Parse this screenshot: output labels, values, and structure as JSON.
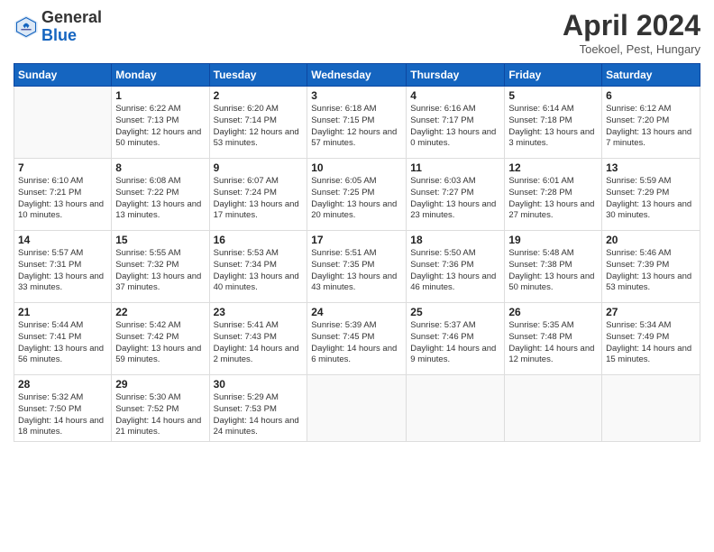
{
  "header": {
    "logo_general": "General",
    "logo_blue": "Blue",
    "month_title": "April 2024",
    "location": "Toekoel, Pest, Hungary"
  },
  "days_of_week": [
    "Sunday",
    "Monday",
    "Tuesday",
    "Wednesday",
    "Thursday",
    "Friday",
    "Saturday"
  ],
  "weeks": [
    [
      {
        "day": "",
        "empty": true
      },
      {
        "day": "1",
        "sunrise": "6:22 AM",
        "sunset": "7:13 PM",
        "daylight": "12 hours and 50 minutes."
      },
      {
        "day": "2",
        "sunrise": "6:20 AM",
        "sunset": "7:14 PM",
        "daylight": "12 hours and 53 minutes."
      },
      {
        "day": "3",
        "sunrise": "6:18 AM",
        "sunset": "7:15 PM",
        "daylight": "12 hours and 57 minutes."
      },
      {
        "day": "4",
        "sunrise": "6:16 AM",
        "sunset": "7:17 PM",
        "daylight": "13 hours and 0 minutes."
      },
      {
        "day": "5",
        "sunrise": "6:14 AM",
        "sunset": "7:18 PM",
        "daylight": "13 hours and 3 minutes."
      },
      {
        "day": "6",
        "sunrise": "6:12 AM",
        "sunset": "7:20 PM",
        "daylight": "13 hours and 7 minutes."
      }
    ],
    [
      {
        "day": "7",
        "sunrise": "6:10 AM",
        "sunset": "7:21 PM",
        "daylight": "13 hours and 10 minutes."
      },
      {
        "day": "8",
        "sunrise": "6:08 AM",
        "sunset": "7:22 PM",
        "daylight": "13 hours and 13 minutes."
      },
      {
        "day": "9",
        "sunrise": "6:07 AM",
        "sunset": "7:24 PM",
        "daylight": "13 hours and 17 minutes."
      },
      {
        "day": "10",
        "sunrise": "6:05 AM",
        "sunset": "7:25 PM",
        "daylight": "13 hours and 20 minutes."
      },
      {
        "day": "11",
        "sunrise": "6:03 AM",
        "sunset": "7:27 PM",
        "daylight": "13 hours and 23 minutes."
      },
      {
        "day": "12",
        "sunrise": "6:01 AM",
        "sunset": "7:28 PM",
        "daylight": "13 hours and 27 minutes."
      },
      {
        "day": "13",
        "sunrise": "5:59 AM",
        "sunset": "7:29 PM",
        "daylight": "13 hours and 30 minutes."
      }
    ],
    [
      {
        "day": "14",
        "sunrise": "5:57 AM",
        "sunset": "7:31 PM",
        "daylight": "13 hours and 33 minutes."
      },
      {
        "day": "15",
        "sunrise": "5:55 AM",
        "sunset": "7:32 PM",
        "daylight": "13 hours and 37 minutes."
      },
      {
        "day": "16",
        "sunrise": "5:53 AM",
        "sunset": "7:34 PM",
        "daylight": "13 hours and 40 minutes."
      },
      {
        "day": "17",
        "sunrise": "5:51 AM",
        "sunset": "7:35 PM",
        "daylight": "13 hours and 43 minutes."
      },
      {
        "day": "18",
        "sunrise": "5:50 AM",
        "sunset": "7:36 PM",
        "daylight": "13 hours and 46 minutes."
      },
      {
        "day": "19",
        "sunrise": "5:48 AM",
        "sunset": "7:38 PM",
        "daylight": "13 hours and 50 minutes."
      },
      {
        "day": "20",
        "sunrise": "5:46 AM",
        "sunset": "7:39 PM",
        "daylight": "13 hours and 53 minutes."
      }
    ],
    [
      {
        "day": "21",
        "sunrise": "5:44 AM",
        "sunset": "7:41 PM",
        "daylight": "13 hours and 56 minutes."
      },
      {
        "day": "22",
        "sunrise": "5:42 AM",
        "sunset": "7:42 PM",
        "daylight": "13 hours and 59 minutes."
      },
      {
        "day": "23",
        "sunrise": "5:41 AM",
        "sunset": "7:43 PM",
        "daylight": "14 hours and 2 minutes."
      },
      {
        "day": "24",
        "sunrise": "5:39 AM",
        "sunset": "7:45 PM",
        "daylight": "14 hours and 6 minutes."
      },
      {
        "day": "25",
        "sunrise": "5:37 AM",
        "sunset": "7:46 PM",
        "daylight": "14 hours and 9 minutes."
      },
      {
        "day": "26",
        "sunrise": "5:35 AM",
        "sunset": "7:48 PM",
        "daylight": "14 hours and 12 minutes."
      },
      {
        "day": "27",
        "sunrise": "5:34 AM",
        "sunset": "7:49 PM",
        "daylight": "14 hours and 15 minutes."
      }
    ],
    [
      {
        "day": "28",
        "sunrise": "5:32 AM",
        "sunset": "7:50 PM",
        "daylight": "14 hours and 18 minutes."
      },
      {
        "day": "29",
        "sunrise": "5:30 AM",
        "sunset": "7:52 PM",
        "daylight": "14 hours and 21 minutes."
      },
      {
        "day": "30",
        "sunrise": "5:29 AM",
        "sunset": "7:53 PM",
        "daylight": "14 hours and 24 minutes."
      },
      {
        "day": "",
        "empty": true
      },
      {
        "day": "",
        "empty": true
      },
      {
        "day": "",
        "empty": true
      },
      {
        "day": "",
        "empty": true
      }
    ]
  ]
}
